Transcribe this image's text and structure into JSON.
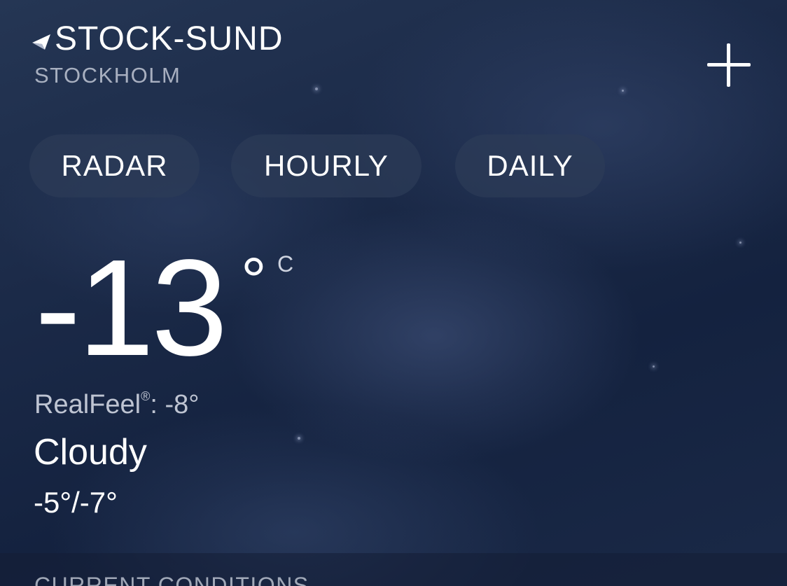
{
  "header": {
    "city": "STOCK-SUND",
    "region": "STOCKHOLM",
    "location_icon": "location-arrow-icon",
    "add_icon": "plus-icon"
  },
  "tabs": [
    {
      "label": "RADAR"
    },
    {
      "label": "HOURLY"
    },
    {
      "label": "DAILY"
    }
  ],
  "current": {
    "temperature": "-13",
    "degree_symbol": "°",
    "unit": "C",
    "realfeel_label": "RealFeel",
    "realfeel_mark": "®",
    "realfeel_value": ": -8°",
    "condition": "Cloudy",
    "high_low": "-5°/-7°"
  },
  "section": {
    "title": "CURRENT CONDITIONS"
  },
  "colors": {
    "background_dark": "#14223f",
    "tab_background": "#2c3c58",
    "text_primary": "#ffffff",
    "text_secondary": "#dce1eb"
  }
}
